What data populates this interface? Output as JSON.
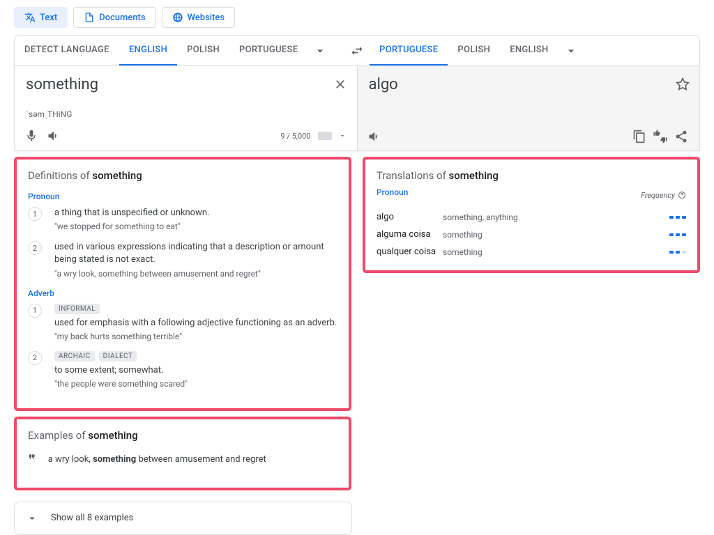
{
  "tabs": {
    "text": "Text",
    "documents": "Documents",
    "websites": "Websites"
  },
  "languages": {
    "source": {
      "detect": "DETECT LANGUAGE",
      "english": "ENGLISH",
      "polish": "POLISH",
      "portuguese": "PORTUGUESE"
    },
    "target": {
      "portuguese": "PORTUGUESE",
      "polish": "POLISH",
      "english": "ENGLISH"
    }
  },
  "source": {
    "text": "something",
    "phonetic": "ˈsəmˌTHiNG",
    "char_count": "9 / 5,000"
  },
  "target": {
    "text": "algo"
  },
  "definitions": {
    "title_prefix": "Definitions of ",
    "title_word": "something",
    "groups": [
      {
        "pos": "Pronoun",
        "items": [
          {
            "num": "1",
            "tags": [],
            "def": "a thing that is unspecified or unknown.",
            "example": "\"we stopped for something to eat\""
          },
          {
            "num": "2",
            "tags": [],
            "def": "used in various expressions indicating that a description or amount being stated is not exact.",
            "example": "\"a wry look, something between amusement and regret\""
          }
        ]
      },
      {
        "pos": "Adverb",
        "items": [
          {
            "num": "1",
            "tags": [
              "INFORMAL"
            ],
            "def": "used for emphasis with a following adjective functioning as an adverb.",
            "example": "\"my back hurts something terrible\""
          },
          {
            "num": "2",
            "tags": [
              "ARCHAIC",
              "DIALECT"
            ],
            "def": "to some extent; somewhat.",
            "example": "\"the people were something scared\""
          }
        ]
      }
    ]
  },
  "translations": {
    "title_prefix": "Translations of ",
    "title_word": "something",
    "pos": "Pronoun",
    "freq_label": "Frequency",
    "rows": [
      {
        "word": "algo",
        "syn": "something, anything",
        "freq": 3
      },
      {
        "word": "alguma coisa",
        "syn": "something",
        "freq": 3
      },
      {
        "word": "qualquer coisa",
        "syn": "something",
        "freq": 2
      }
    ]
  },
  "examples": {
    "title_prefix": "Examples of ",
    "title_word": "something",
    "item_pre": "a wry look, ",
    "item_bold": "something",
    "item_post": " between amusement and regret",
    "show_all": "Show all 8 examples"
  }
}
